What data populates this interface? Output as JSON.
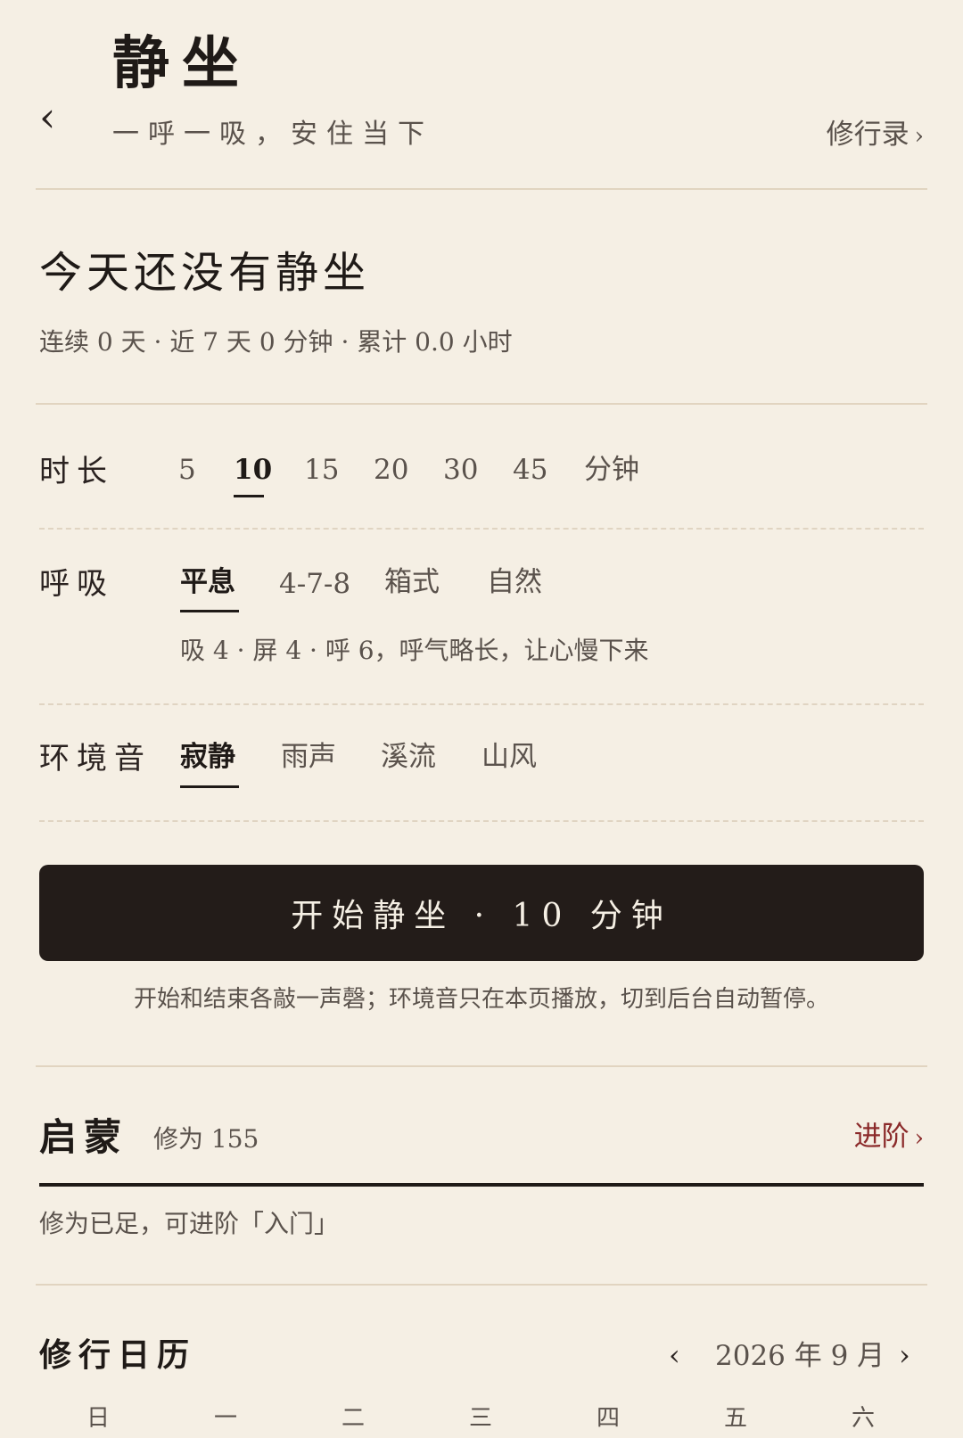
{
  "header": {
    "back_icon": "‹",
    "title": "静坐",
    "subtitle": "一呼一吸，安住当下",
    "log_link": "修行录",
    "log_chevron": "›"
  },
  "status": {
    "title": "今天还没有静坐",
    "stats": "连续 0 天 · 近 7 天 0 分钟 · 累计 0.0 小时"
  },
  "duration": {
    "label": "时长",
    "options": [
      "5",
      "10",
      "15",
      "20",
      "30",
      "45"
    ],
    "selected": "10",
    "unit": "分钟"
  },
  "breath": {
    "label": "呼吸",
    "options": [
      "平息",
      "4-7-8",
      "箱式",
      "自然"
    ],
    "selected": "平息",
    "description": "吸 4 · 屏 4 · 呼 6，呼气略长，让心慢下来"
  },
  "ambient": {
    "label": "环境音",
    "options": [
      "寂静",
      "雨声",
      "溪流",
      "山风"
    ],
    "selected": "寂静"
  },
  "start": {
    "button_label": "开始静坐 · 10 分钟",
    "note": "开始和结束各敲一声磬；环境音只在本页播放，切到后台自动暂停。"
  },
  "level": {
    "name": "启蒙",
    "xiuwei": "修为 155",
    "advance_link": "进阶",
    "advance_chevron": "›",
    "advance_note": "修为已足，可进阶「入门」"
  },
  "calendar": {
    "title": "修行日历",
    "prev_icon": "‹",
    "month": "2026 年 9 月",
    "next_icon": "›",
    "weekdays": [
      "日",
      "一",
      "二",
      "三",
      "四",
      "五",
      "六"
    ]
  },
  "colors": {
    "background": "#f5efe4",
    "text": "#1f1a17",
    "muted": "#5a524c",
    "accent_red": "#8b2a2a",
    "button": "#231c19",
    "divider": "#e1d4c0"
  }
}
